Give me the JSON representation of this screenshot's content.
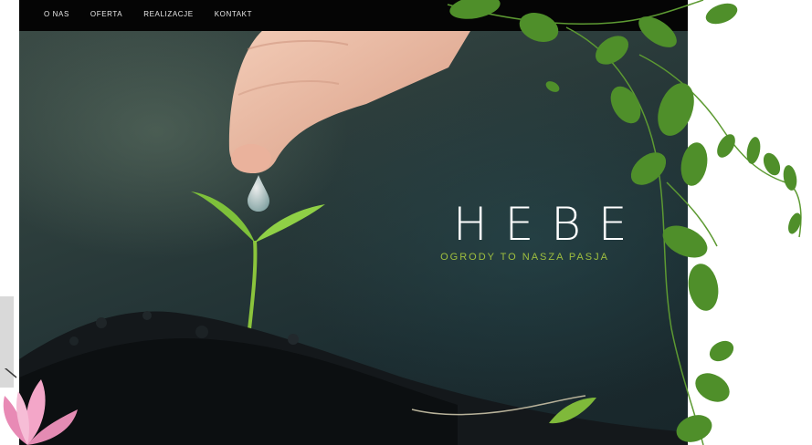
{
  "nav": {
    "items": [
      {
        "label": "O NAS"
      },
      {
        "label": "OFERTA"
      },
      {
        "label": "REALIZACJE"
      },
      {
        "label": "KONTAKT"
      }
    ]
  },
  "hero": {
    "title": "HEBE",
    "tagline": "OGRODY TO NASZA PASJA"
  },
  "colors": {
    "nav_bg": "#050505",
    "title": "#ffffff",
    "tagline": "#9fbf3f",
    "leaf": "#4e8a2a"
  }
}
